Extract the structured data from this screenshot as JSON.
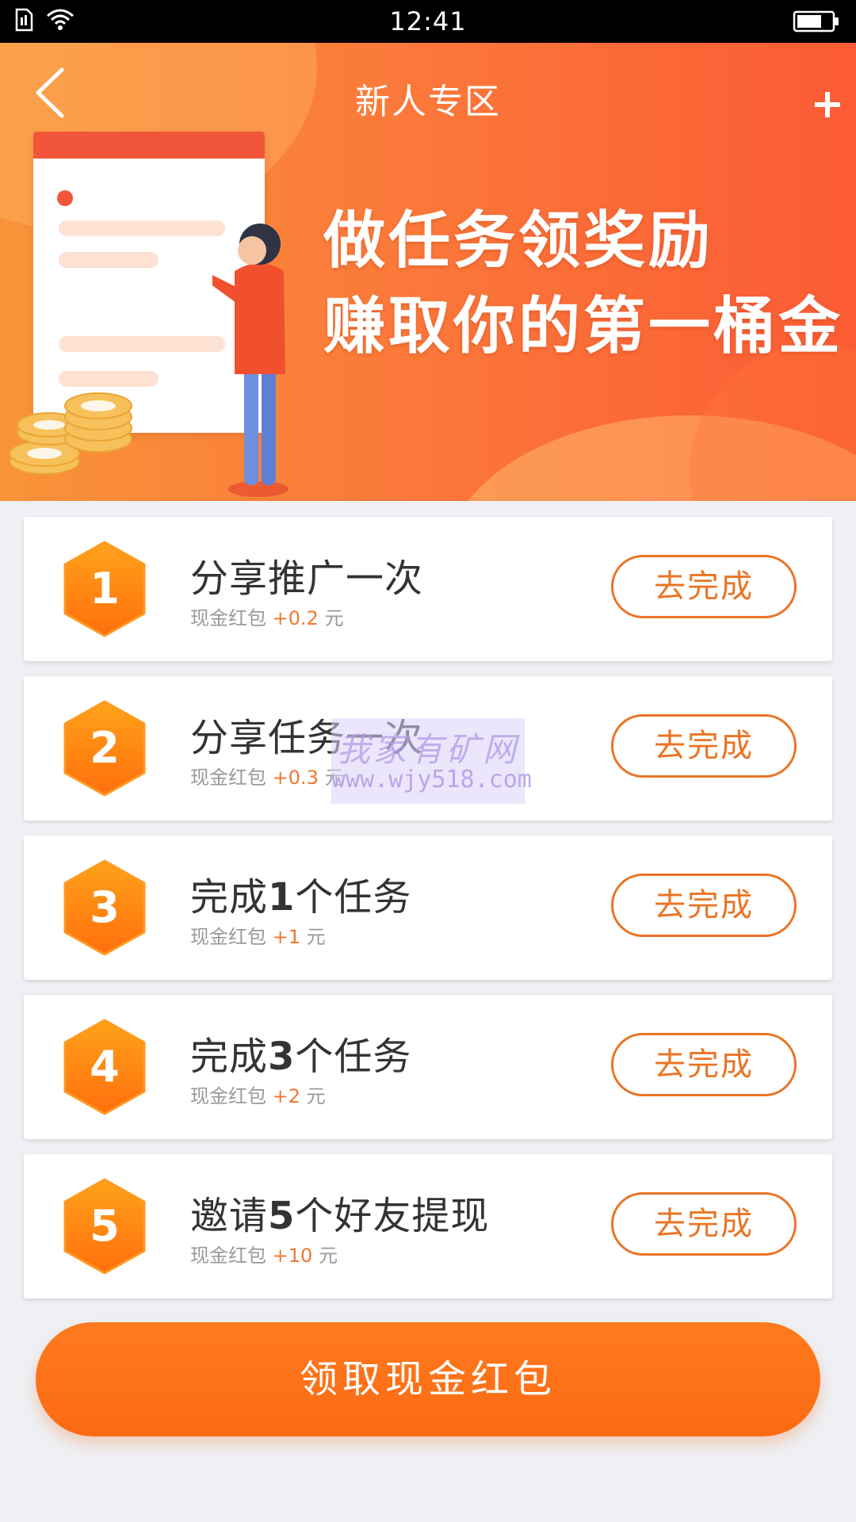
{
  "status_bar": {
    "time": "12:41"
  },
  "header": {
    "title": "新人专区"
  },
  "banner": {
    "slogan_line1": "做任务领奖励",
    "slogan_line2": "赚取你的第一桶金"
  },
  "tasks": [
    {
      "number": "1",
      "title": "分享推广一次",
      "reward_label": "现金红包",
      "reward_amount": "+0.2",
      "unit": "元",
      "button": "去完成"
    },
    {
      "number": "2",
      "title": "分享任务一次",
      "reward_label": "现金红包",
      "reward_amount": "+0.3",
      "unit": "元",
      "button": "去完成"
    },
    {
      "number": "3",
      "title_pre": "完成",
      "title_num": "1",
      "title_post": "个任务",
      "reward_label": "现金红包",
      "reward_amount": "+1",
      "unit": "元",
      "button": "去完成"
    },
    {
      "number": "4",
      "title_pre": "完成",
      "title_num": "3",
      "title_post": "个任务",
      "reward_label": "现金红包",
      "reward_amount": "+2",
      "unit": "元",
      "button": "去完成"
    },
    {
      "number": "5",
      "title_pre": "邀请",
      "title_num": "5",
      "title_post": "个好友提现",
      "reward_label": "现金红包",
      "reward_amount": "+10",
      "unit": "元",
      "button": "去完成"
    }
  ],
  "claim_button": "领取现金红包",
  "watermark": {
    "line1": "我家有矿网",
    "line2": "www.wjy518.com"
  },
  "colors": {
    "accent": "#ea7425",
    "hex_top": "#ffa21a",
    "hex_bottom": "#ff6f0d",
    "claim": "#fb6a12"
  },
  "icons": {
    "back": "chevron-left-icon",
    "plus": "plus-icon",
    "wifi": "wifi-icon",
    "sim": "sim-icon",
    "battery": "battery-icon"
  }
}
